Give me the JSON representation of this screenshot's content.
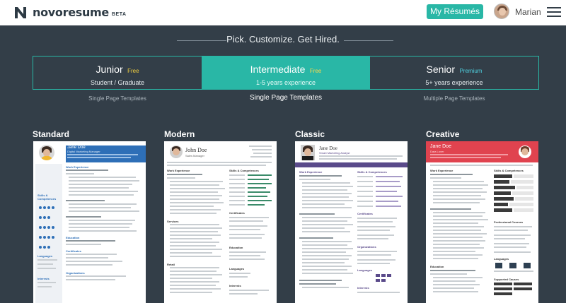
{
  "header": {
    "logo_text": "novoresume",
    "logo_badge": "BETA",
    "my_resumes_label": "My Résumés",
    "username": "Marian"
  },
  "tagline": "Pick. Customize. Get Hired.",
  "levels": [
    {
      "name": "Junior",
      "tag": "Free",
      "subtitle": "Student / Graduate",
      "templates_label": "Single Page Templates",
      "active": false
    },
    {
      "name": "Intermediate",
      "tag": "Free",
      "subtitle": "1-5 years experience",
      "templates_label": "Single Page Templates",
      "active": true
    },
    {
      "name": "Senior",
      "tag": "Premium",
      "subtitle": "5+ years experience",
      "templates_label": "Multiple Page Templates",
      "active": false
    }
  ],
  "templates": [
    {
      "title": "Standard",
      "name": "Jane Doe",
      "role": "Digital Marketing Manager"
    },
    {
      "title": "Modern",
      "name": "John Doe",
      "role": "Sales Manager"
    },
    {
      "title": "Classic",
      "name": "Jane Doe",
      "role": "Smart Marketing Analyst"
    },
    {
      "title": "Creative",
      "name": "Jane Doe",
      "role": "Data Lover"
    }
  ],
  "colors": {
    "accent": "#29b7a6",
    "background": "#333e48",
    "standard_header": "#2e6fb7",
    "classic_bar": "#5a4a8a",
    "creative_header": "#e0434f"
  }
}
